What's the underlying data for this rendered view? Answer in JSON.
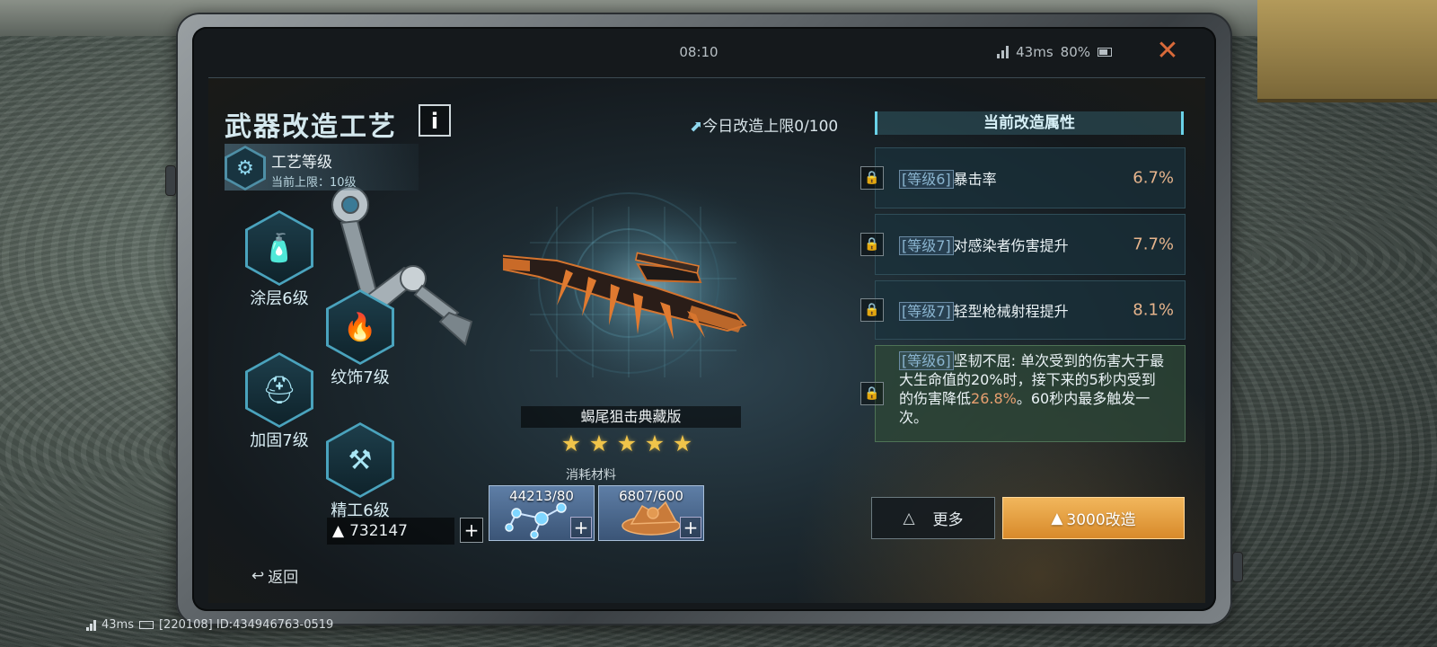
{
  "status": {
    "time": "08:10",
    "ping": "43ms",
    "battery": "80%"
  },
  "icons": {
    "close": "close-icon",
    "info": "info-icon",
    "gear": "gear-icon",
    "coating": "spray-can-icon",
    "decoration": "flame-icon",
    "reinforce": "welding-mask-icon",
    "precision": "drill-icon",
    "currency": "crystal-icon",
    "back": "back-arrow-icon",
    "limit": "up-arrow-icon",
    "lock": "lock-icon",
    "more": "triangle-up-icon"
  },
  "header": {
    "title": "武器改造工艺",
    "info_label": "i",
    "daily_limit": "今日改造上限0/100"
  },
  "craft": {
    "label": "工艺等级",
    "current_limit": "当前上限：10级"
  },
  "mods": [
    {
      "label": "涂层6级"
    },
    {
      "label": "纹饰7级"
    },
    {
      "label": "加固7级"
    },
    {
      "label": "精工6级"
    }
  ],
  "currency": {
    "amount": "732147",
    "add_label": "+"
  },
  "back_label": "返回",
  "weapon": {
    "name": "蝎尾狙击典藏版",
    "stars": 5,
    "star_glyph": "★",
    "materials_label": "消耗材料",
    "materials": [
      {
        "count": "44213/80",
        "icon": "molecule-icon"
      },
      {
        "count": "6807/600",
        "icon": "ore-pile-icon"
      }
    ],
    "plus_label": "+"
  },
  "attributes": {
    "header": "当前改造属性",
    "rows": [
      {
        "tag": "[等级6]",
        "name": "暴击率",
        "value": "6.7%"
      },
      {
        "tag": "[等级7]",
        "name": "对感染者伤害提升",
        "value": "7.7%"
      },
      {
        "tag": "[等级7]",
        "name": "轻型枪械射程提升",
        "value": "8.1%"
      }
    ],
    "special": {
      "tag": "[等级6]",
      "text_before": "坚韧不屈: 单次受到的伤害大于最大生命值的20%时，接下来的5秒内受到的伤害降低",
      "highlight": "26.8%",
      "text_after": "。60秒内最多触发一次。"
    }
  },
  "buttons": {
    "more": "更多",
    "modify": "3000改造"
  },
  "footer": {
    "ping": "43ms",
    "id": "[220108] ID:434946763-0519"
  },
  "colors": {
    "accent_cyan": "#6ad2e8",
    "accent_orange": "#d88a2a",
    "value_orange": "#e6b48c",
    "star_gold": "#f0c44a",
    "close_orange": "#d96a3a"
  }
}
